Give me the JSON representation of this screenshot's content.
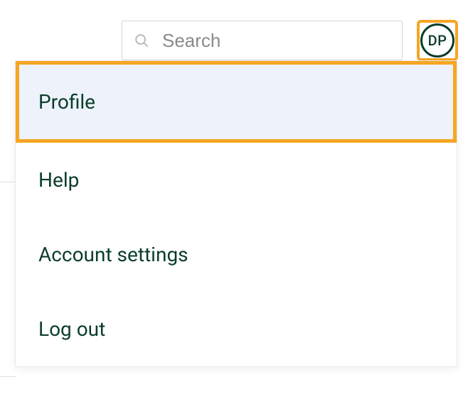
{
  "search": {
    "placeholder": "Search"
  },
  "avatar": {
    "initials": "DP"
  },
  "menu": {
    "items": [
      {
        "label": "Profile",
        "highlighted": true
      },
      {
        "label": "Help",
        "highlighted": false
      },
      {
        "label": "Account settings",
        "highlighted": false
      },
      {
        "label": "Log out",
        "highlighted": false
      }
    ]
  },
  "colors": {
    "highlight_border": "#f5a623",
    "highlight_bg": "#edf2fb",
    "text_dark": "#0a3d2a"
  }
}
